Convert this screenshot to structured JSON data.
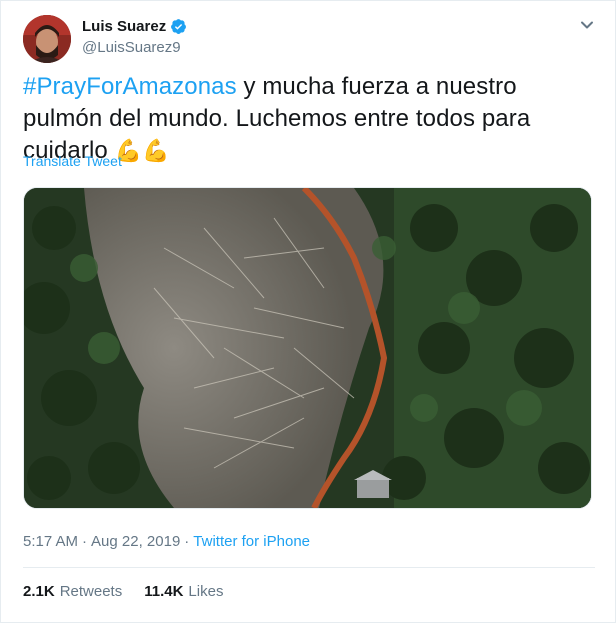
{
  "user": {
    "display_name": "Luis Suarez",
    "handle": "@LuisSuarez9",
    "verified": true
  },
  "tweet": {
    "hashtag": "#PrayForAmazonas",
    "text": " y mucha fuerza a nuestro pulmón del mundo. Luchemos entre todos para cuidarlo ",
    "emoji": "💪💪",
    "translate_label": "Translate Tweet",
    "media_alt": "Aerial photo of deforested Amazon land",
    "time": "5:17 AM",
    "date": "Aug 22, 2019",
    "separator": "·",
    "source": "Twitter for iPhone"
  },
  "stats": {
    "retweets_count": "2.1K",
    "retweets_label": "Retweets",
    "likes_count": "11.4K",
    "likes_label": "Likes"
  },
  "colors": {
    "accent": "#1da1f2",
    "muted": "#657786",
    "text": "#14171a"
  },
  "icons": [
    "verified-badge-icon",
    "chevron-down-icon"
  ]
}
